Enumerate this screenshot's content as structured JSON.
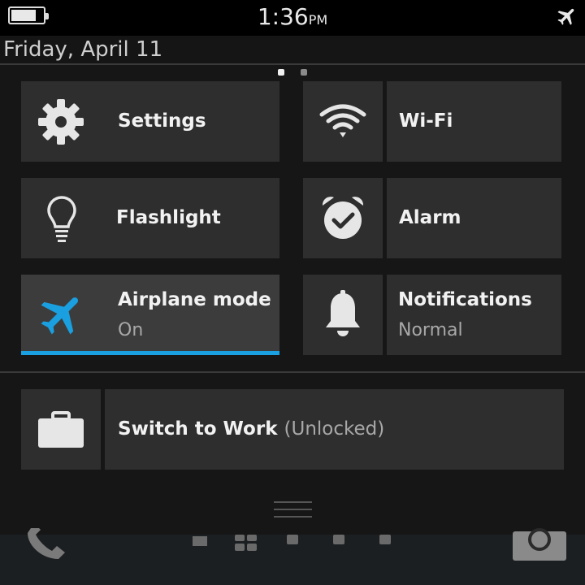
{
  "status": {
    "time": "1:36",
    "ampm": "PM",
    "battery_level": 0.8
  },
  "date": "Friday, April 11",
  "pager": {
    "pages": 2,
    "current": 0
  },
  "tiles": {
    "settings": {
      "label": "Settings",
      "icon": "gear-icon"
    },
    "wifi": {
      "label": "Wi-Fi",
      "icon": "wifi-icon"
    },
    "flashlight": {
      "label": "Flashlight",
      "icon": "lightbulb-icon"
    },
    "alarm": {
      "label": "Alarm",
      "icon": "alarm-clock-icon"
    },
    "airplane": {
      "label": "Airplane mode",
      "state": "On",
      "icon": "airplane-icon",
      "active": true
    },
    "notifications": {
      "label": "Notifications",
      "state": "Normal",
      "icon": "bell-icon"
    }
  },
  "work": {
    "label": "Switch to Work",
    "status": "(Unlocked)",
    "icon": "briefcase-icon"
  },
  "colors": {
    "accent": "#1a9fe0",
    "tile": "#2e2e2e",
    "tile_active": "#3c3c3c",
    "background": "#161616"
  }
}
